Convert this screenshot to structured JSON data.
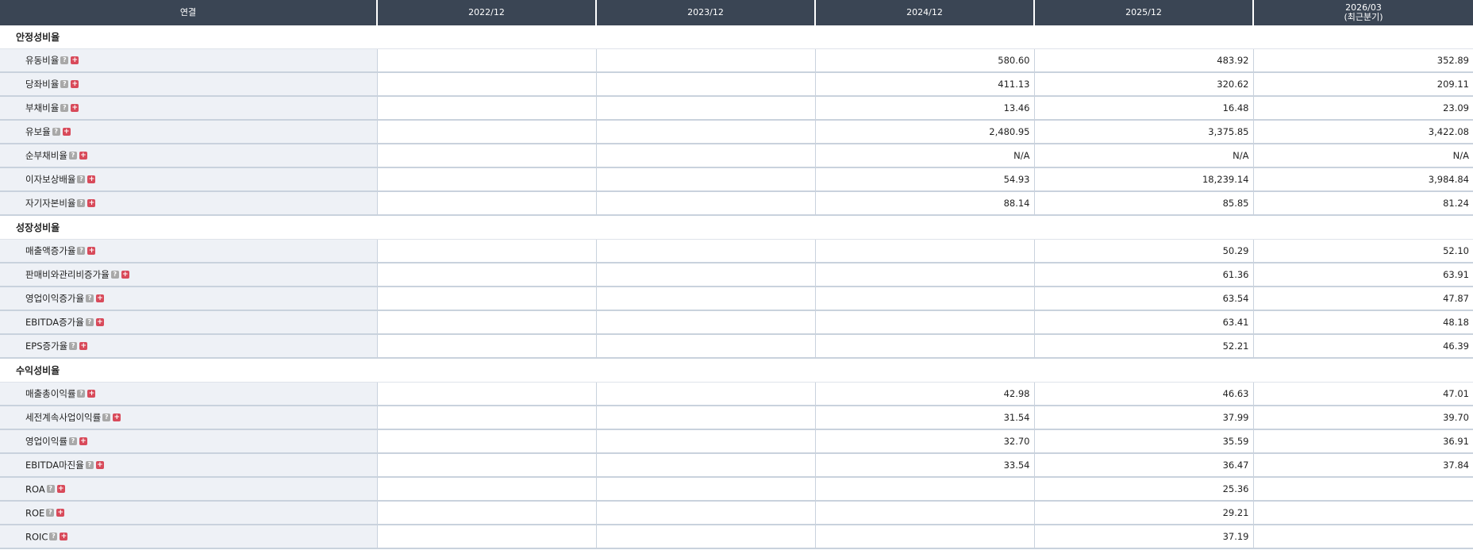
{
  "header": {
    "label_col": "연결",
    "periods": [
      "2022/12",
      "2023/12",
      "2024/12",
      "2025/12",
      "2026/03"
    ],
    "latest_note": "(최근분기)"
  },
  "sections": [
    {
      "title": "안정성비율",
      "rows": [
        {
          "label": "유동비율",
          "values": [
            "",
            "",
            "580.60",
            "483.92",
            "352.89"
          ]
        },
        {
          "label": "당좌비율",
          "values": [
            "",
            "",
            "411.13",
            "320.62",
            "209.11"
          ]
        },
        {
          "label": "부채비율",
          "values": [
            "",
            "",
            "13.46",
            "16.48",
            "23.09"
          ]
        },
        {
          "label": "유보율",
          "values": [
            "",
            "",
            "2,480.95",
            "3,375.85",
            "3,422.08"
          ]
        },
        {
          "label": "순부채비율",
          "values": [
            "",
            "",
            "N/A",
            "N/A",
            "N/A"
          ]
        },
        {
          "label": "이자보상배율",
          "values": [
            "",
            "",
            "54.93",
            "18,239.14",
            "3,984.84"
          ]
        },
        {
          "label": "자기자본비율",
          "values": [
            "",
            "",
            "88.14",
            "85.85",
            "81.24"
          ]
        }
      ]
    },
    {
      "title": "성장성비율",
      "rows": [
        {
          "label": "매출액증가율",
          "values": [
            "",
            "",
            "",
            "50.29",
            "52.10"
          ]
        },
        {
          "label": "판매비와관리비증가율",
          "values": [
            "",
            "",
            "",
            "61.36",
            "63.91"
          ]
        },
        {
          "label": "영업이익증가율",
          "values": [
            "",
            "",
            "",
            "63.54",
            "47.87"
          ]
        },
        {
          "label": "EBITDA증가율",
          "values": [
            "",
            "",
            "",
            "63.41",
            "48.18"
          ]
        },
        {
          "label": "EPS증가율",
          "values": [
            "",
            "",
            "",
            "52.21",
            "46.39"
          ]
        }
      ]
    },
    {
      "title": "수익성비율",
      "rows": [
        {
          "label": "매출총이익률",
          "values": [
            "",
            "",
            "42.98",
            "46.63",
            "47.01"
          ]
        },
        {
          "label": "세전계속사업이익률",
          "values": [
            "",
            "",
            "31.54",
            "37.99",
            "39.70"
          ]
        },
        {
          "label": "영업이익률",
          "values": [
            "",
            "",
            "32.70",
            "35.59",
            "36.91"
          ]
        },
        {
          "label": "EBITDA마진율",
          "values": [
            "",
            "",
            "33.54",
            "36.47",
            "37.84"
          ]
        },
        {
          "label": "ROA",
          "values": [
            "",
            "",
            "",
            "25.36",
            ""
          ]
        },
        {
          "label": "ROE",
          "values": [
            "",
            "",
            "",
            "29.21",
            ""
          ]
        },
        {
          "label": "ROIC",
          "values": [
            "",
            "",
            "",
            "37.19",
            ""
          ]
        }
      ]
    }
  ],
  "icons": {
    "help": {
      "name": "help-icon",
      "glyph": "?",
      "color": "#a8a8a8"
    },
    "expand": {
      "name": "expand-plus-icon",
      "glyph": "+",
      "color": "#d84a5a"
    }
  },
  "colors": {
    "header_bg": "#3a4554",
    "label_bg": "#eef1f6",
    "row_border": "#c9d2dd"
  }
}
